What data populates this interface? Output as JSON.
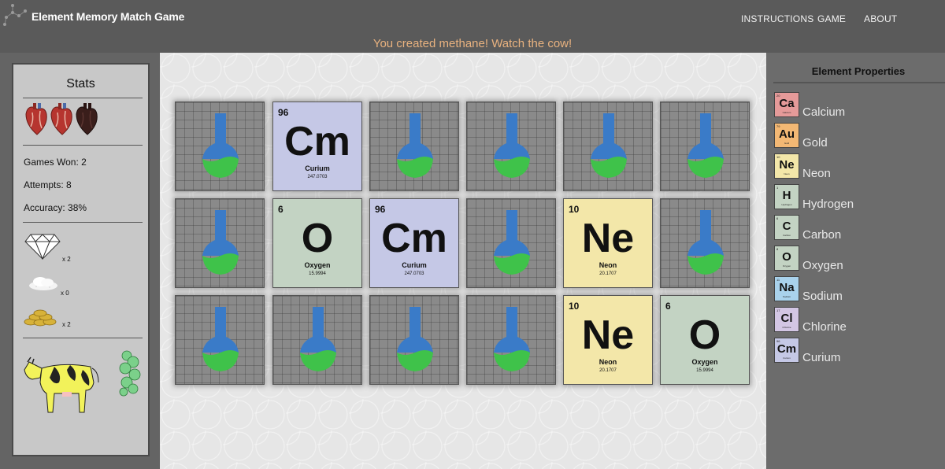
{
  "header": {
    "title": "Element Memory Match Game",
    "nav": [
      "INSTRUCTIONS",
      "GAME",
      "ABOUT"
    ],
    "message": "You created methane! Watch the cow!"
  },
  "stats": {
    "title": "Stats",
    "games_won": "Games Won: 2",
    "attempts": "Attempts: 8",
    "accuracy": "Accuracy: 38%",
    "lives_remaining": 2,
    "lives_total": 3,
    "items": [
      {
        "icon": "diamond-icon",
        "count": "x 2"
      },
      {
        "icon": "salt-icon",
        "count": "x 0"
      },
      {
        "icon": "gold-coins-icon",
        "count": "x 2"
      }
    ]
  },
  "board": {
    "cards": [
      {
        "state": "down"
      },
      {
        "state": "up",
        "number": "96",
        "symbol": "Cm",
        "name": "Curium",
        "mass": "247.0703",
        "color": "#c5c8e6"
      },
      {
        "state": "down"
      },
      {
        "state": "down"
      },
      {
        "state": "down"
      },
      {
        "state": "down"
      },
      {
        "state": "down"
      },
      {
        "state": "up",
        "number": "6",
        "symbol": "O",
        "name": "Oxygen",
        "mass": "15.9994",
        "color": "#c3d3c3"
      },
      {
        "state": "up",
        "number": "96",
        "symbol": "Cm",
        "name": "Curium",
        "mass": "247.0703",
        "color": "#c5c8e6"
      },
      {
        "state": "down"
      },
      {
        "state": "up",
        "number": "10",
        "symbol": "Ne",
        "name": "Neon",
        "mass": "20.1707",
        "color": "#f3e7a9"
      },
      {
        "state": "down"
      },
      {
        "state": "down"
      },
      {
        "state": "down"
      },
      {
        "state": "down"
      },
      {
        "state": "down"
      },
      {
        "state": "up",
        "number": "10",
        "symbol": "Ne",
        "name": "Neon",
        "mass": "20.1707",
        "color": "#f3e7a9"
      },
      {
        "state": "up",
        "number": "6",
        "symbol": "O",
        "name": "Oxygen",
        "mass": "15.9994",
        "color": "#c3d3c3"
      }
    ]
  },
  "properties": {
    "title": "Element Properties",
    "elements": [
      {
        "number": "20",
        "symbol": "Ca",
        "name": "Calcium",
        "color": "#e59a99"
      },
      {
        "number": "79",
        "symbol": "Au",
        "name": "Gold",
        "color": "#f3b874"
      },
      {
        "number": "10",
        "symbol": "Ne",
        "name": "Neon",
        "color": "#f3e7a9"
      },
      {
        "number": "1",
        "symbol": "H",
        "name": "Hydrogen",
        "color": "#c3d3c3"
      },
      {
        "number": "6",
        "symbol": "C",
        "name": "Carbon",
        "color": "#c3d3c3"
      },
      {
        "number": "8",
        "symbol": "O",
        "name": "Oxygen",
        "color": "#c3d3c3"
      },
      {
        "number": "11",
        "symbol": "Na",
        "name": "Sodium",
        "color": "#a9d2ec"
      },
      {
        "number": "17",
        "symbol": "Cl",
        "name": "Chlorine",
        "color": "#d3c6e4"
      },
      {
        "number": "96",
        "symbol": "Cm",
        "name": "Curium",
        "color": "#c5c8e6"
      }
    ]
  }
}
